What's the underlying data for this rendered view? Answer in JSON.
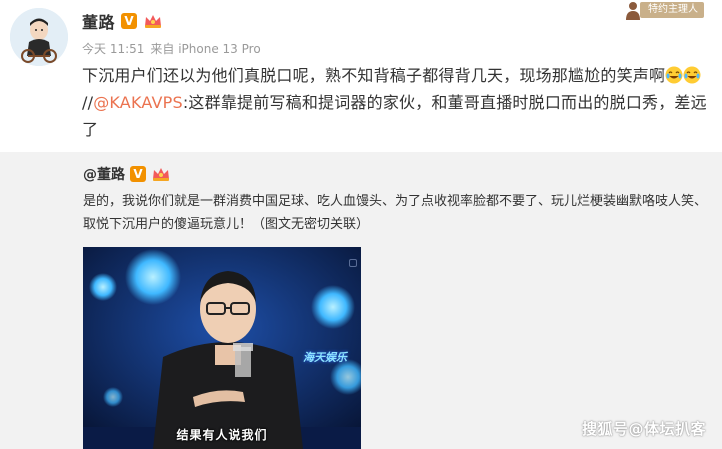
{
  "post": {
    "username": "董路",
    "verified_badge": "V",
    "tag_label": "特约主理人",
    "timestamp": "今天 11:51",
    "source": "来自 iPhone 13 Pro",
    "text_part1": "下沉用户们还以为他们真脱口呢，熟不知背稿子都得背几天，现场那尴尬的笑声啊",
    "text_part2": "//",
    "mention": "@KAKAVPS",
    "text_part3": ":这群靠提前写稿和提词器的家伙，和董哥直播时脱口而出的脱口秀，差远了",
    "emoji_names": [
      "laugh-cry-emoji",
      "laugh-cry-emoji"
    ]
  },
  "repost": {
    "username": "@董路",
    "verified_badge": "V",
    "text": "是的，我说你们就是一群消费中国足球、吃人血馒头、为了点收视率脸都不要了、玩儿烂梗装幽默咯吱人笑、取悦下沉用户的傻逼玩意儿！（图文无密切关联）",
    "video_subtitle": "结果有人说我们",
    "video_logo": "海天娱乐"
  },
  "credit": "搜狐号@体坛扒客",
  "colors": {
    "mention": "#eb7350",
    "badge_orange": "#f29100",
    "tag_bg": "#c9b08a",
    "repost_bg": "#f2f2f2"
  }
}
